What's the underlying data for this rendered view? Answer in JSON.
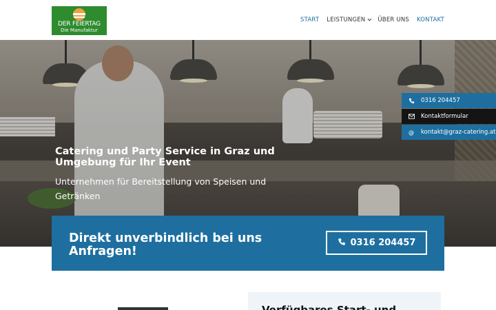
{
  "header": {
    "logo": {
      "line1": "DER FEIERTAG",
      "line2": "Die Manufaktur"
    },
    "nav": [
      {
        "label": "START",
        "active": true
      },
      {
        "label": "LEISTUNGEN",
        "active": false,
        "has_dropdown": true
      },
      {
        "label": "ÜBER UNS",
        "active": false
      },
      {
        "label": "KONTAKT",
        "active": false
      }
    ]
  },
  "hero": {
    "title": "Catering und Party Service in Graz und Umgebung für Ihr Event",
    "subtitle": "Unternehmen für Bereitstellung von Speisen und Getränken"
  },
  "contact_bar": {
    "phone": {
      "icon": "phone-icon",
      "label": "0316 204457"
    },
    "form": {
      "icon": "envelope-icon",
      "label": "Kontaktformular"
    },
    "email": {
      "icon": "at-icon",
      "label": "kontakt@graz-catering.at"
    }
  },
  "cta": {
    "text": "Direkt unverbindlich bei uns Anfragen!",
    "button_label": "0316 204457"
  },
  "below": {
    "card_title": "Verfügbares Start- und"
  },
  "colors": {
    "accent": "#1e6fa0",
    "logo_green": "#2e8b2e",
    "nav_active": "#1a6e9e"
  }
}
